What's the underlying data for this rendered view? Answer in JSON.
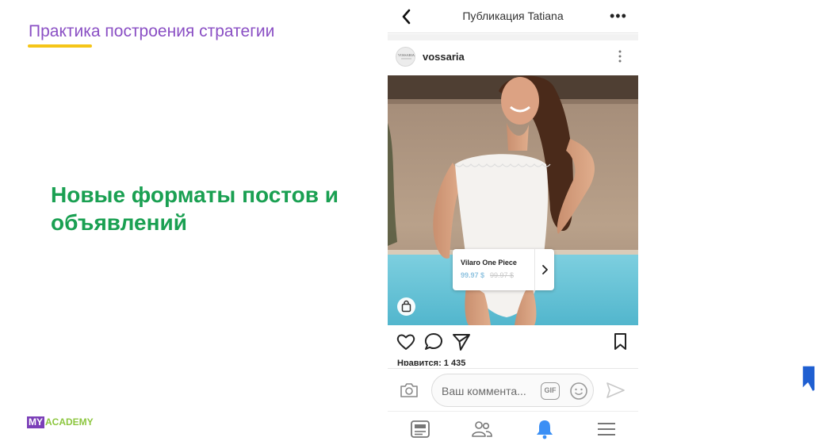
{
  "slide": {
    "title": "Практика построения стратегии",
    "heading": "Новые форматы постов и объявлений",
    "logo_my": "MY",
    "logo_academy": "ACADEMY"
  },
  "colors": {
    "title": "#8a4fc4",
    "underline": "#f5c518",
    "heading": "#1aa052",
    "logo_my_bg": "#7b3fb8",
    "logo_academy": "#8cc63f",
    "active_tab": "#3b8ff5"
  },
  "phone": {
    "header": {
      "back_icon": "chevron-left-icon",
      "title": "Публикация Tatiana",
      "more_icon": "more-horizontal-icon",
      "more_glyph": "•••"
    },
    "post": {
      "username": "vossaria",
      "avatar_text": "VOSSARIA",
      "menu_icon": "more-vertical-icon",
      "product_tag": {
        "name": "Vilaro One Piece",
        "price": "99.97 $",
        "old_price": "99.97 $"
      },
      "likes": "Нравится: 1 435"
    },
    "actions": [
      "heart-icon",
      "comment-icon",
      "send-icon",
      "bookmark-icon"
    ],
    "comment": {
      "placeholder": "Ваш коммента...",
      "gif_label": "GIF"
    },
    "tabs": [
      "news-feed-icon",
      "friends-icon",
      "notifications-bell-icon",
      "menu-icon"
    ],
    "active_tab": "notifications-bell-icon"
  }
}
